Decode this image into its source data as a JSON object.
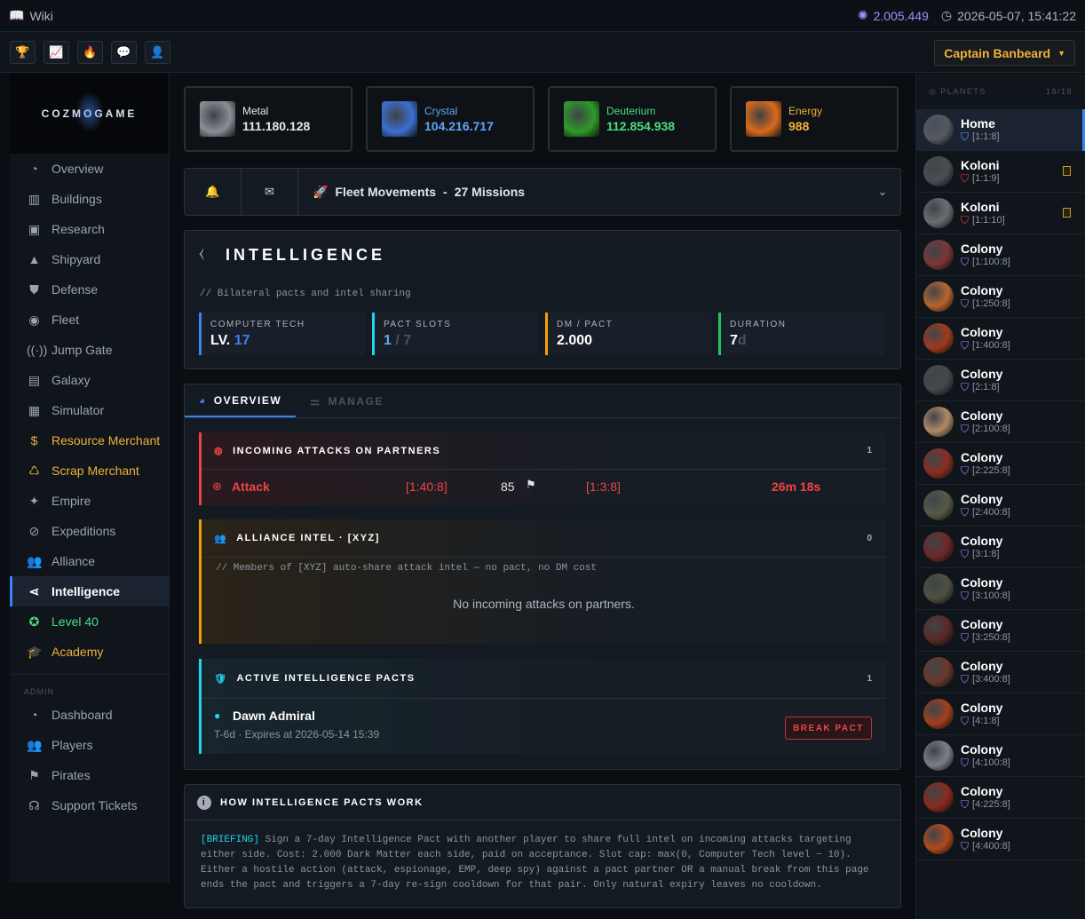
{
  "top": {
    "wiki": "Wiki",
    "dm": "2.005.449",
    "datetime": "2026-05-07, 15:41:22"
  },
  "user": {
    "name": "Captain Banbeard"
  },
  "logo": "COZMOGAME",
  "nav": [
    {
      "label": "Overview",
      "icon": "dashboard-icon",
      "style": ""
    },
    {
      "label": "Buildings",
      "icon": "buildings-icon",
      "style": ""
    },
    {
      "label": "Research",
      "icon": "chip-icon",
      "style": ""
    },
    {
      "label": "Shipyard",
      "icon": "rocket-icon",
      "style": ""
    },
    {
      "label": "Defense",
      "icon": "shield-icon",
      "style": ""
    },
    {
      "label": "Fleet",
      "icon": "target-icon",
      "style": ""
    },
    {
      "label": "Jump Gate",
      "icon": "signal-icon",
      "style": ""
    },
    {
      "label": "Galaxy",
      "icon": "galaxy-icon",
      "style": ""
    },
    {
      "label": "Simulator",
      "icon": "calculator-icon",
      "style": ""
    },
    {
      "label": "Resource Merchant",
      "icon": "coin-icon",
      "style": "gold"
    },
    {
      "label": "Scrap Merchant",
      "icon": "recycle-icon",
      "style": "gold"
    },
    {
      "label": "Empire",
      "icon": "sparkle-icon",
      "style": ""
    },
    {
      "label": "Expeditions",
      "icon": "compass-icon",
      "style": ""
    },
    {
      "label": "Alliance",
      "icon": "group-icon",
      "style": ""
    },
    {
      "label": "Intelligence",
      "icon": "share-icon",
      "style": "active"
    },
    {
      "label": "Level 40",
      "icon": "award-icon",
      "style": "green"
    },
    {
      "label": "Academy",
      "icon": "graduation-icon",
      "style": "gold"
    }
  ],
  "admin_label": "ADMIN",
  "admin_nav": [
    {
      "label": "Dashboard",
      "icon": "gauge-icon"
    },
    {
      "label": "Players",
      "icon": "users-icon"
    },
    {
      "label": "Pirates",
      "icon": "flag-icon"
    },
    {
      "label": "Support Tickets",
      "icon": "headset-icon"
    }
  ],
  "resources": [
    {
      "name": "Metal",
      "value": "111.180.128",
      "color": "#e6e6e6",
      "img": "#8a8f96"
    },
    {
      "name": "Crystal",
      "value": "104.216.717",
      "color": "#60a5fa",
      "img": "#3b6fd1"
    },
    {
      "name": "Deuterium",
      "value": "112.854.938",
      "color": "#4ade80",
      "img": "#2f9a2a"
    },
    {
      "name": "Energy",
      "value": "988",
      "color": "#f0b03a",
      "img": "#d96a1c"
    }
  ],
  "fleet": {
    "text": "Fleet Movements",
    "count": "27 Missions",
    "sep": "-"
  },
  "intel": {
    "title": "INTELLIGENCE",
    "subtitle": "// Bilateral pacts and intel sharing",
    "stats": [
      {
        "label": "COMPUTER TECH",
        "prefix": "LV.",
        "value": "17",
        "color": "#3b82f6"
      },
      {
        "label": "PACT SLOTS",
        "prefix": "",
        "value": "1",
        "suffix": " / 7",
        "color": "#22d3ee"
      },
      {
        "label": "DM / PACT",
        "prefix": "",
        "value": "2.000",
        "color": "#f59e0b"
      },
      {
        "label": "DURATION",
        "prefix": "",
        "value": "7",
        "suffix": "d",
        "color": "#22c55e"
      }
    ]
  },
  "tabs": {
    "overview": "OVERVIEW",
    "manage": "MANAGE"
  },
  "incoming": {
    "title": "INCOMING ATTACKS ON PARTNERS",
    "count": "1",
    "row": {
      "type": "Attack",
      "from": "[1:40:8]",
      "ships": "85",
      "to": "[1:3:8]",
      "eta": "26m 18s"
    }
  },
  "alliance": {
    "title": "ALLIANCE INTEL · [XYZ]",
    "count": "0",
    "note": "// Members of [XYZ] auto-share attack intel — no pact, no DM cost",
    "empty": "No incoming attacks on partners."
  },
  "pacts": {
    "title": "ACTIVE INTELLIGENCE PACTS",
    "count": "1",
    "name": "Dawn Admiral",
    "meta": "T-6d · Expires at 2026-05-14 15:39",
    "button": "BREAK PACT"
  },
  "how": {
    "title": "HOW INTELLIGENCE PACTS WORK",
    "tag": "[BRIEFING]",
    "text": " Sign a 7-day Intelligence Pact with another player to share full intel on incoming attacks targeting either side. Cost: 2.000 Dark Matter each side, paid on acceptance. Slot cap: max(0, Computer Tech level − 10). Either a hostile action (attack, espionage, EMP, deep spy) against a pact partner OR a manual break from this page ends the pact and triggers a 7-day re-sign cooldown for that pair. Only natural expiry leaves no cooldown."
  },
  "planets_header": {
    "label": "PLANETS",
    "count": "18/18"
  },
  "planets": [
    {
      "name": "Home",
      "coord": "[1:1:8]",
      "shield": "#60a5fa",
      "col": "#555a60",
      "sel": true,
      "flag": false
    },
    {
      "name": "Koloni",
      "coord": "[1:1:9]",
      "shield": "#ef4444",
      "col": "#4a4d52",
      "sel": false,
      "flag": true
    },
    {
      "name": "Koloni",
      "coord": "[1:1:10]",
      "shield": "#ef4444",
      "col": "#6a6d72",
      "sel": false,
      "flag": true
    },
    {
      "name": "Colony",
      "coord": "[1:100:8]",
      "shield": "#a78bfa",
      "col": "#7a3838",
      "sel": false,
      "flag": false
    },
    {
      "name": "Colony",
      "coord": "[1:250:8]",
      "shield": "#a78bfa",
      "col": "#b8652e",
      "sel": false,
      "flag": false
    },
    {
      "name": "Colony",
      "coord": "[1:400:8]",
      "shield": "#a78bfa",
      "col": "#a03a1e",
      "sel": false,
      "flag": false
    },
    {
      "name": "Colony",
      "coord": "[2:1:8]",
      "shield": "#a78bfa",
      "col": "#45474c",
      "sel": false,
      "flag": false
    },
    {
      "name": "Colony",
      "coord": "[2:100:8]",
      "shield": "#a78bfa",
      "col": "#b08a66",
      "sel": false,
      "flag": false
    },
    {
      "name": "Colony",
      "coord": "[2:225:8]",
      "shield": "#a78bfa",
      "col": "#8a2e22",
      "sel": false,
      "flag": false
    },
    {
      "name": "Colony",
      "coord": "[2:400:8]",
      "shield": "#a78bfa",
      "col": "#565a44",
      "sel": false,
      "flag": false
    },
    {
      "name": "Colony",
      "coord": "[3:1:8]",
      "shield": "#a78bfa",
      "col": "#6e2828",
      "sel": false,
      "flag": false
    },
    {
      "name": "Colony",
      "coord": "[3:100:8]",
      "shield": "#a78bfa",
      "col": "#4e5040",
      "sel": false,
      "flag": false
    },
    {
      "name": "Colony",
      "coord": "[3:250:8]",
      "shield": "#a78bfa",
      "col": "#5a2a24",
      "sel": false,
      "flag": false
    },
    {
      "name": "Colony",
      "coord": "[3:400:8]",
      "shield": "#a78bfa",
      "col": "#6a3a2a",
      "sel": false,
      "flag": false
    },
    {
      "name": "Colony",
      "coord": "[4:1:8]",
      "shield": "#a78bfa",
      "col": "#a0401e",
      "sel": false,
      "flag": false
    },
    {
      "name": "Colony",
      "coord": "[4:100:8]",
      "shield": "#a78bfa",
      "col": "#7a8088",
      "sel": false,
      "flag": false
    },
    {
      "name": "Colony",
      "coord": "[4:225:8]",
      "shield": "#a78bfa",
      "col": "#8a2a1e",
      "sel": false,
      "flag": false
    },
    {
      "name": "Colony",
      "coord": "[4:400:8]",
      "shield": "#a78bfa",
      "col": "#b04a1e",
      "sel": false,
      "flag": false
    }
  ]
}
